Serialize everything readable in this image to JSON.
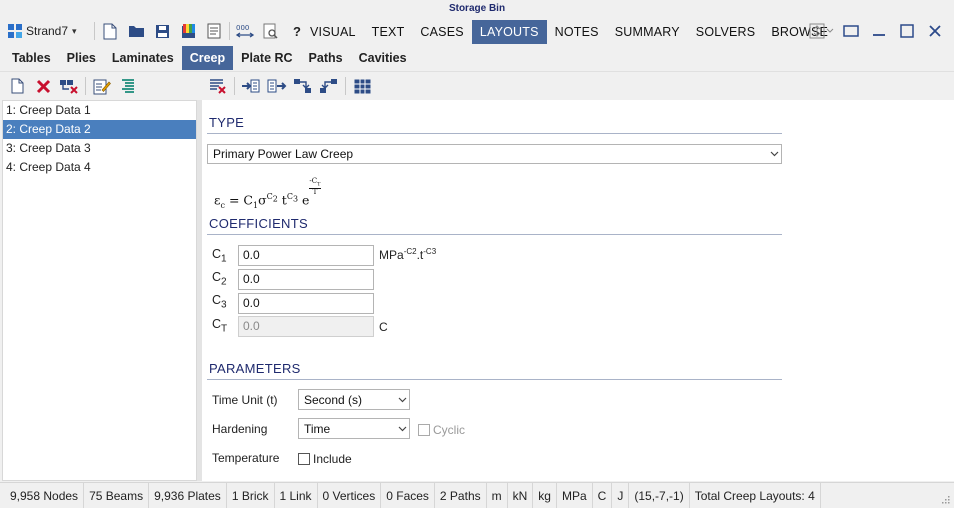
{
  "window": {
    "title": "Storage Bin"
  },
  "brand": {
    "name": "Strand7"
  },
  "ribbon_tabs": [
    {
      "label": "VISUAL"
    },
    {
      "label": "TEXT"
    },
    {
      "label": "CASES"
    },
    {
      "label": "LAYOUTS",
      "active": true
    },
    {
      "label": "NOTES"
    },
    {
      "label": "SUMMARY"
    },
    {
      "label": "SOLVERS"
    },
    {
      "label": "BROWSE"
    }
  ],
  "quick_access": {
    "units_icon_text": "000",
    "help_label": "?"
  },
  "sub_tabs": [
    {
      "label": "Tables"
    },
    {
      "label": "Plies"
    },
    {
      "label": "Laminates"
    },
    {
      "label": "Creep",
      "active": true
    },
    {
      "label": "Plate RC"
    },
    {
      "label": "Paths"
    },
    {
      "label": "Cavities"
    }
  ],
  "creep_list": [
    {
      "label": "1: Creep Data 1"
    },
    {
      "label": "2: Creep Data 2",
      "selected": true
    },
    {
      "label": "3: Creep Data 3"
    },
    {
      "label": "4: Creep Data 4"
    }
  ],
  "detail": {
    "type_section": {
      "title": "TYPE",
      "type_value": "Primary Power Law Creep"
    },
    "formula": {
      "lhs": "ε",
      "lhs_sub": "c",
      "equals": " = ",
      "c1": "C",
      "c1_sub": "1",
      "sigma": "σ",
      "c2_sup": "C",
      "c2_sup_sub": "2",
      "t": " t",
      "c3_sup": "C",
      "c3_sup_sub": "3",
      "e": " e",
      "exp_num": "-C",
      "exp_num_sub": "T",
      "exp_den": "T"
    },
    "coefficients": {
      "title": "COEFFICIENTS",
      "rows": [
        {
          "label": "C",
          "sub": "1",
          "value": "0.0",
          "disabled": false
        },
        {
          "label": "C",
          "sub": "2",
          "value": "0.0",
          "disabled": false
        },
        {
          "label": "C",
          "sub": "3",
          "value": "0.0",
          "disabled": false
        },
        {
          "label": "C",
          "sub": "T",
          "value": "0.0",
          "disabled": true
        }
      ],
      "c1_unit": {
        "base": "MPa",
        "sup1": "-C2",
        "mid": ".t",
        "sup2": "-C3"
      },
      "ct_unit": "C"
    },
    "parameters": {
      "title": "PARAMETERS",
      "time_unit_label": "Time Unit (t)",
      "time_unit_value": "Second (s)",
      "hardening_label": "Hardening",
      "hardening_value": "Time",
      "cyclic_label": "Cyclic",
      "cyclic_checked": false,
      "temperature_label": "Temperature",
      "include_label": "Include",
      "include_checked": false
    }
  },
  "status_bar": [
    {
      "text": "9,958 Nodes"
    },
    {
      "text": "75 Beams"
    },
    {
      "text": "9,936 Plates"
    },
    {
      "text": "1 Brick"
    },
    {
      "text": "1 Link"
    },
    {
      "text": "0 Vertices"
    },
    {
      "text": "0 Faces"
    },
    {
      "text": "2 Paths"
    },
    {
      "text": "m"
    },
    {
      "text": "kN"
    },
    {
      "text": "kg"
    },
    {
      "text": "MPa"
    },
    {
      "text": "C"
    },
    {
      "text": "J"
    },
    {
      "text": "(15,-7,-1)"
    },
    {
      "text": "Total Creep Layouts: 4"
    }
  ],
  "colors": {
    "accent": "#46669a",
    "selection": "#4a7fbe",
    "section_title": "#1f2a6e",
    "delete_red": "#c8102e"
  }
}
